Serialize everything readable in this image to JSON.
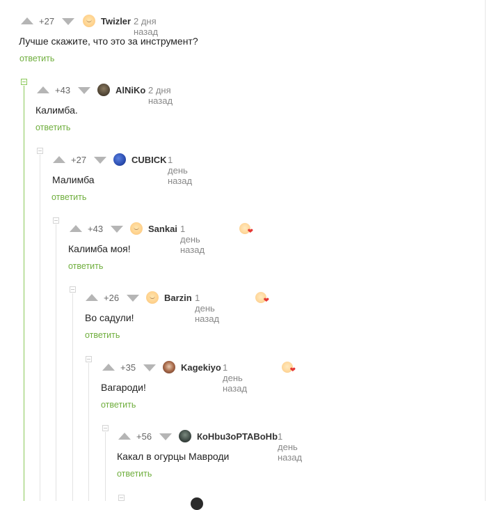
{
  "reply_label": "ответить",
  "comments": [
    {
      "rating": "+27",
      "author": "Twizler",
      "time": "2 дня назад",
      "text": "Лучше скажите, что это за инструмент?",
      "avatar": "avatar-icon"
    },
    {
      "rating": "+43",
      "author": "AlNiKo",
      "time": "2 дня назад",
      "text": "Калимба.",
      "avatar": "avatar-icon"
    },
    {
      "rating": "+27",
      "author": "CUBICK",
      "time": "1 день назад",
      "text": "Малимба",
      "avatar": "avatar-icon"
    },
    {
      "rating": "+43",
      "author": "Sankai",
      "time": "1 день назад",
      "text": "Калимба моя!",
      "avatar": "avatar-icon",
      "badge": "heart-badge-icon"
    },
    {
      "rating": "+26",
      "author": "Barzin",
      "time": "1 день назад",
      "text": "Во садули!",
      "avatar": "avatar-icon",
      "badge": "heart-badge-icon"
    },
    {
      "rating": "+35",
      "author": "Kagekiyo",
      "time": "1 день назад",
      "text": "Вагароди!",
      "avatar": "avatar-icon",
      "badge": "heart-badge-icon"
    },
    {
      "rating": "+56",
      "author": "КоНbu3оPTABoHb",
      "time": "1 день назад",
      "text": "Какал в огурцы Мавроди",
      "avatar": "avatar-icon"
    }
  ],
  "colors": {
    "reply_link": "#6fae3d",
    "thread_line_active": "#8ac858",
    "thread_line": "#e2e2e2",
    "vote_arrow": "#b5b5b5"
  }
}
